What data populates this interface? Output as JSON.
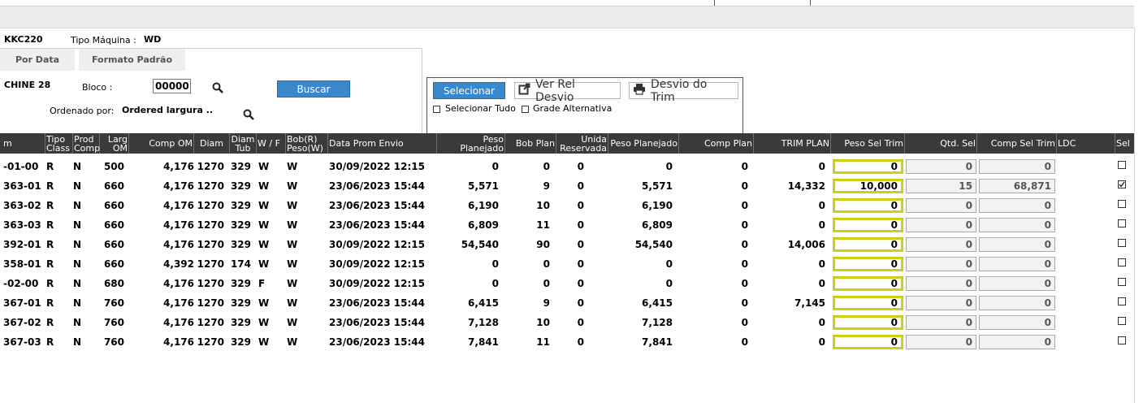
{
  "filters": {
    "machine_code": "KKC220",
    "tipo_maquina_label": "Tipo Máquina :",
    "tipo_maquina_value": "WD",
    "tabs": [
      "Por Data",
      "Formato Padrão"
    ],
    "machine_name": "CHINE 28",
    "bloco_label": "Bloco :",
    "bloco_value": "00000",
    "buscar_label": "Buscar",
    "ordenado_label": "Ordenado por:",
    "ordenado_value": "Ordered largura .."
  },
  "actions": {
    "selecionar": "Selecionar",
    "ver_rel_desvio": "Ver Rel Desvio",
    "desvio_trim": "Desvio do Trim",
    "selecionar_tudo": "Selecionar Tudo",
    "grade_alternativa": "Grade Alternativa"
  },
  "table": {
    "headers": {
      "om": "m",
      "tipo_class": "Tipo Class",
      "prod_comp": "Prod Comp",
      "larg_om": "Larg OM",
      "comp_om": "Comp OM",
      "diam": "Diam",
      "diam_tub": "Diam Tub",
      "wf": "W / F",
      "bob": "Bob(R) Peso(W)",
      "data_prom": "Data Prom Envio",
      "peso_plan": "Peso Planejado",
      "bob_plan": "Bob Plan",
      "unid_res": "Unida Reservada",
      "peso_plan2": "Peso Planejado",
      "comp_plan": "Comp Plan",
      "trim_plan": "TRIM PLAN",
      "peso_sel_trim": "Peso Sel Trim",
      "qtd_sel": "Qtd. Sel",
      "comp_sel_trim": "Comp Sel Trim",
      "ldc": "LDC",
      "sel": "Sel"
    },
    "rows": [
      {
        "om": "-01-00",
        "tipo": "R",
        "prod": "N",
        "larg": "500",
        "comp": "4,176",
        "diam": "1270",
        "tub": "329",
        "wf": "W",
        "bob": "W",
        "data": "30/09/2022 12:15",
        "peso": "0",
        "bobplan": "0",
        "unid": "0",
        "peso2": "0",
        "compplan": "0",
        "trim": "0",
        "pesosel": "0",
        "qtd": "0",
        "compsel": "0",
        "checked": false
      },
      {
        "om": "363-01",
        "tipo": "R",
        "prod": "N",
        "larg": "660",
        "comp": "4,176",
        "diam": "1270",
        "tub": "329",
        "wf": "W",
        "bob": "W",
        "data": "23/06/2023 15:44",
        "peso": "5,571",
        "bobplan": "9",
        "unid": "0",
        "peso2": "5,571",
        "compplan": "0",
        "trim": "14,332",
        "pesosel": "10,000",
        "qtd": "15",
        "compsel": "68,871",
        "checked": true
      },
      {
        "om": "363-02",
        "tipo": "R",
        "prod": "N",
        "larg": "660",
        "comp": "4,176",
        "diam": "1270",
        "tub": "329",
        "wf": "W",
        "bob": "W",
        "data": "23/06/2023 15:44",
        "peso": "6,190",
        "bobplan": "10",
        "unid": "0",
        "peso2": "6,190",
        "compplan": "0",
        "trim": "0",
        "pesosel": "0",
        "qtd": "0",
        "compsel": "0",
        "checked": false
      },
      {
        "om": "363-03",
        "tipo": "R",
        "prod": "N",
        "larg": "660",
        "comp": "4,176",
        "diam": "1270",
        "tub": "329",
        "wf": "W",
        "bob": "W",
        "data": "23/06/2023 15:44",
        "peso": "6,809",
        "bobplan": "11",
        "unid": "0",
        "peso2": "6,809",
        "compplan": "0",
        "trim": "0",
        "pesosel": "0",
        "qtd": "0",
        "compsel": "0",
        "checked": false
      },
      {
        "om": "392-01",
        "tipo": "R",
        "prod": "N",
        "larg": "660",
        "comp": "4,176",
        "diam": "1270",
        "tub": "329",
        "wf": "W",
        "bob": "W",
        "data": "30/09/2022 12:15",
        "peso": "54,540",
        "bobplan": "90",
        "unid": "0",
        "peso2": "54,540",
        "compplan": "0",
        "trim": "14,006",
        "pesosel": "0",
        "qtd": "0",
        "compsel": "0",
        "checked": false
      },
      {
        "om": "358-01",
        "tipo": "R",
        "prod": "N",
        "larg": "660",
        "comp": "4,392",
        "diam": "1270",
        "tub": "174",
        "wf": "W",
        "bob": "W",
        "data": "30/09/2022 12:15",
        "peso": "0",
        "bobplan": "0",
        "unid": "0",
        "peso2": "0",
        "compplan": "0",
        "trim": "0",
        "pesosel": "0",
        "qtd": "0",
        "compsel": "0",
        "checked": false
      },
      {
        "om": "-02-00",
        "tipo": "R",
        "prod": "N",
        "larg": "680",
        "comp": "4,176",
        "diam": "1270",
        "tub": "329",
        "wf": "F",
        "bob": "W",
        "data": "30/09/2022 12:15",
        "peso": "0",
        "bobplan": "0",
        "unid": "0",
        "peso2": "0",
        "compplan": "0",
        "trim": "0",
        "pesosel": "0",
        "qtd": "0",
        "compsel": "0",
        "checked": false
      },
      {
        "om": "367-01",
        "tipo": "R",
        "prod": "N",
        "larg": "760",
        "comp": "4,176",
        "diam": "1270",
        "tub": "329",
        "wf": "W",
        "bob": "W",
        "data": "23/06/2023 15:44",
        "peso": "6,415",
        "bobplan": "9",
        "unid": "0",
        "peso2": "6,415",
        "compplan": "0",
        "trim": "7,145",
        "pesosel": "0",
        "qtd": "0",
        "compsel": "0",
        "checked": false
      },
      {
        "om": "367-02",
        "tipo": "R",
        "prod": "N",
        "larg": "760",
        "comp": "4,176",
        "diam": "1270",
        "tub": "329",
        "wf": "W",
        "bob": "W",
        "data": "23/06/2023 15:44",
        "peso": "7,128",
        "bobplan": "10",
        "unid": "0",
        "peso2": "7,128",
        "compplan": "0",
        "trim": "0",
        "pesosel": "0",
        "qtd": "0",
        "compsel": "0",
        "checked": false
      },
      {
        "om": "367-03",
        "tipo": "R",
        "prod": "N",
        "larg": "760",
        "comp": "4,176",
        "diam": "1270",
        "tub": "329",
        "wf": "W",
        "bob": "W",
        "data": "23/06/2023 15:44",
        "peso": "7,841",
        "bobplan": "11",
        "unid": "0",
        "peso2": "7,841",
        "compplan": "0",
        "trim": "0",
        "pesosel": "0",
        "qtd": "0",
        "compsel": "0",
        "checked": false
      }
    ]
  },
  "colors": {
    "header_bg": "#3a3a3a",
    "button_blue": "#3b87cc",
    "peso_border": "#cfcf1a"
  }
}
